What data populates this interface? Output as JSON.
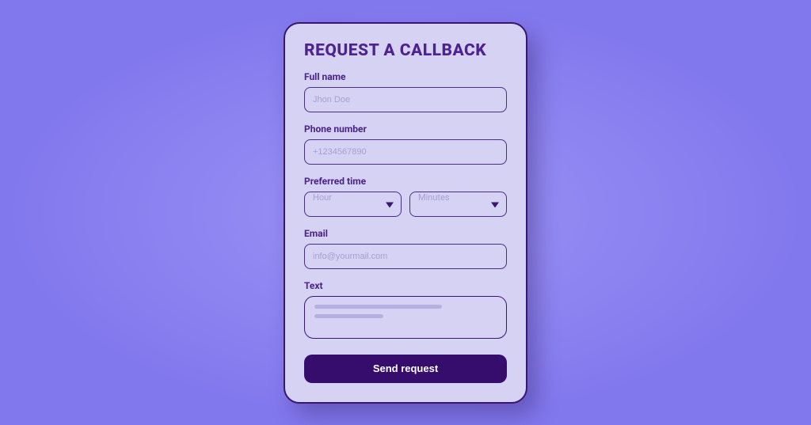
{
  "form": {
    "title": "REQUEST A CALLBACK",
    "fullname": {
      "label": "Full name",
      "placeholder": "Jhon Doe"
    },
    "phone": {
      "label": "Phone number",
      "placeholder": "+1234567890"
    },
    "time": {
      "label": "Preferred time",
      "hour": "Hour",
      "minutes": "Minutes"
    },
    "email": {
      "label": "Email",
      "placeholder": "info@yourmail.com"
    },
    "text": {
      "label": "Text"
    },
    "submit": "Send request"
  }
}
